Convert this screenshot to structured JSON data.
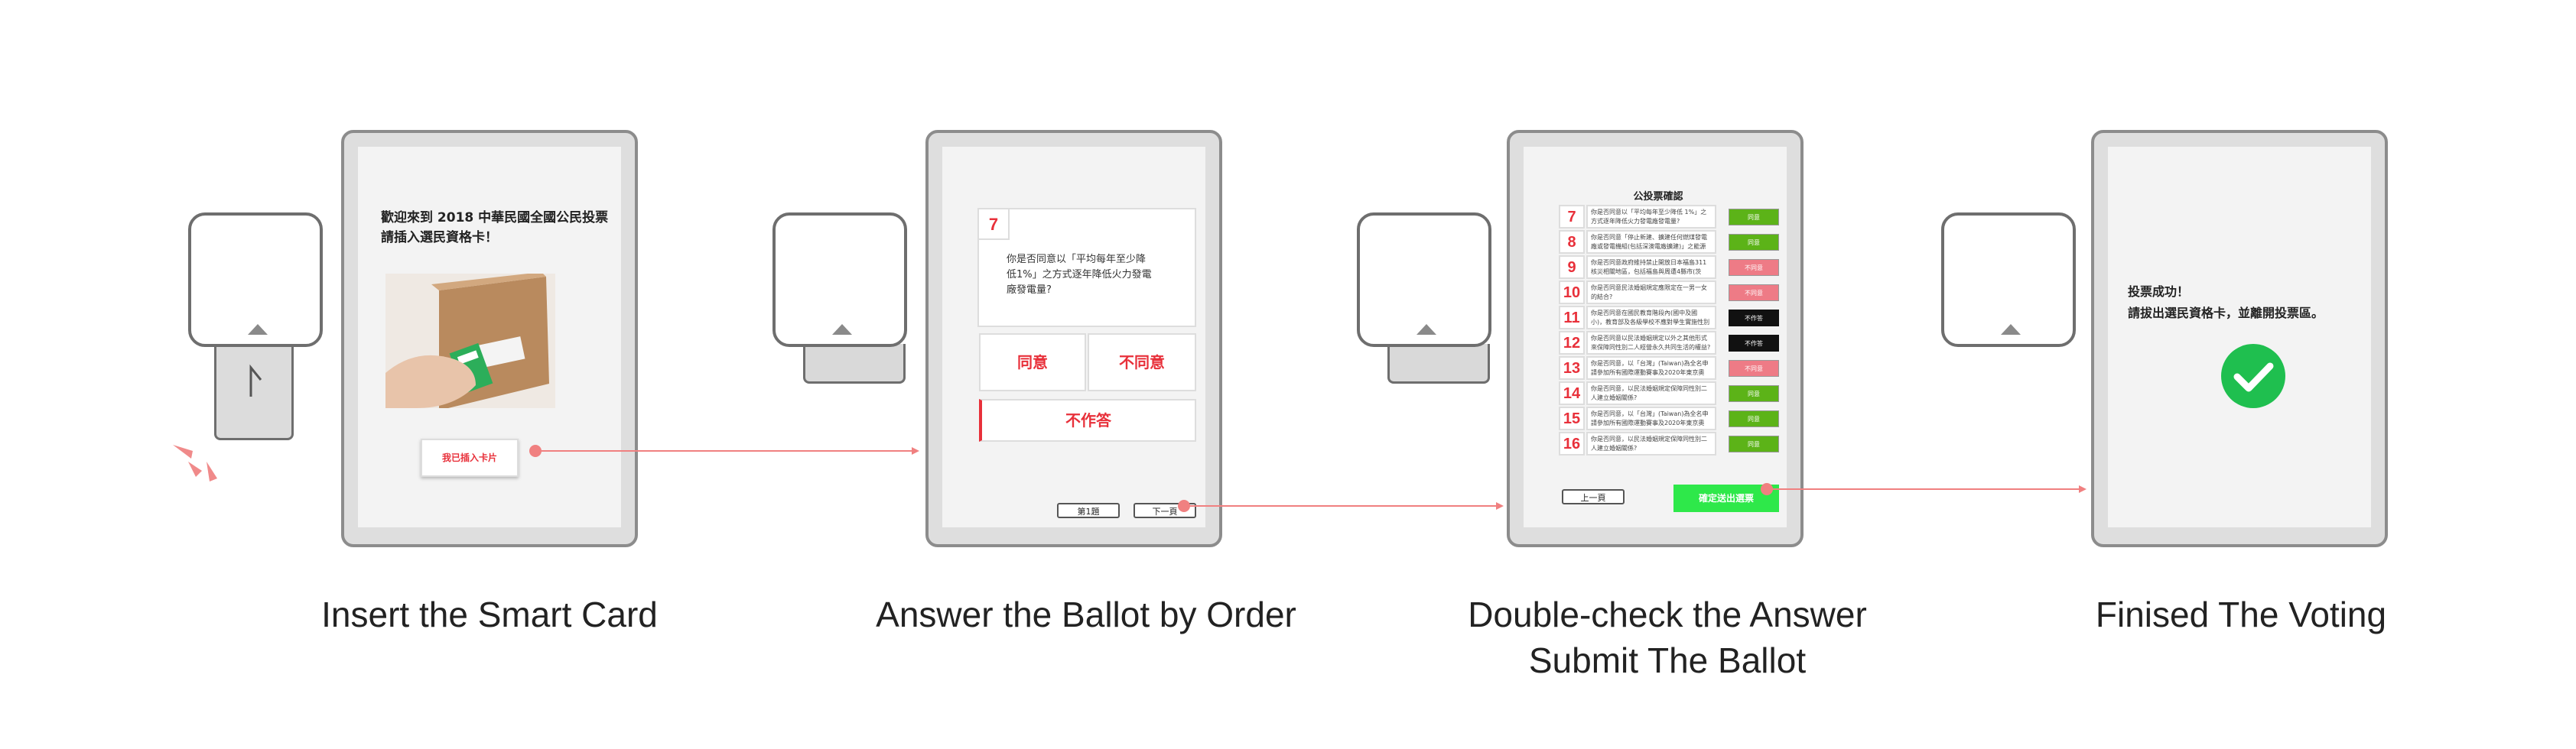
{
  "steps": [
    {
      "caption": "Insert the Smart Card",
      "screen_title": "歡迎來到 2018 中華民國全國公民投票\n請插入選民資格卡！",
      "button": "我已插入卡片"
    },
    {
      "caption": "Answer the Ballot by Order",
      "question_number": "7",
      "question_text": "你是否同意以「平均每年至少降低1%」之方式逐年降低火力發電廠發電量?",
      "agree": "同意",
      "disagree": "不同意",
      "abstain": "不作答",
      "prev": "第1題",
      "next": "下一頁"
    },
    {
      "caption_line1": "Double-check  the Answer",
      "caption_line2": "Submit The Ballot",
      "screen_title": "公投票確認",
      "back": "上一頁",
      "submit": "確定送出選票",
      "rows": [
        {
          "num": "7",
          "text": "你是否同意以「平均每年至少降低 1%」之方式逐年降低火力發電廠發電量?",
          "choice": "同意",
          "color": "#5cb318"
        },
        {
          "num": "8",
          "text": "你是否同意「停止新建、擴建任何燃煤發電廠或發電機組(包括深澳電廠擴建)」之能源政策?",
          "choice": "同意",
          "color": "#5cb318"
        },
        {
          "num": "9",
          "text": "你是否同意政府維持禁止開放日本福島311核災相關地區，包括福島與周遭4縣市(茨城、櫪木、群馬、千葉)等地區農產品及食品進口?",
          "choice": "不同意",
          "color": "#ee7b86"
        },
        {
          "num": "10",
          "text": "你是否同意民法婚姻規定應限定在一男一女的結合?",
          "choice": "不同意",
          "color": "#ee7b86"
        },
        {
          "num": "11",
          "text": "你是否同意在國民教育階段內(國中及國小)，教育部及各級學校不應對學生實施性別平等教育法施行細則所定之同志教育?",
          "choice": "不作答",
          "color": "#111111"
        },
        {
          "num": "12",
          "text": "你是否同意以民法婚姻規定以外之其他形式來保障同性別二人經營永久共同生活的權益?",
          "choice": "不作答",
          "color": "#111111"
        },
        {
          "num": "13",
          "text": "你是否同意，以「台灣」(Taiwan)為全名申請參加所有國際運動賽事及2020年東京奧運?",
          "choice": "不同意",
          "color": "#ee7b86"
        },
        {
          "num": "14",
          "text": "你是否同意，以民法婚姻規定保障同性別二人建立婚姻關係?",
          "choice": "同意",
          "color": "#5cb318"
        },
        {
          "num": "15",
          "text": "你是否同意，以「台灣」(Taiwan)為全名申請參加所有國際運動賽事及2020年東京奧運?",
          "choice": "同意",
          "color": "#5cb318"
        },
        {
          "num": "16",
          "text": "你是否同意，以民法婚姻規定保障同性別二人建立婚姻關係?",
          "choice": "同意",
          "color": "#5cb318"
        }
      ]
    },
    {
      "caption": "Finised The Voting",
      "message": "投票成功！\n請拔出選民資格卡，並離開投票區。"
    }
  ],
  "colors": {
    "accent_red": "#e8303a",
    "connector": "#f08080",
    "submit_green": "#2ee84a",
    "check_green": "#1fbf4f"
  },
  "icons": [
    "card-reader",
    "smart-card",
    "red-signal-lines-icon",
    "check-circle-icon"
  ]
}
